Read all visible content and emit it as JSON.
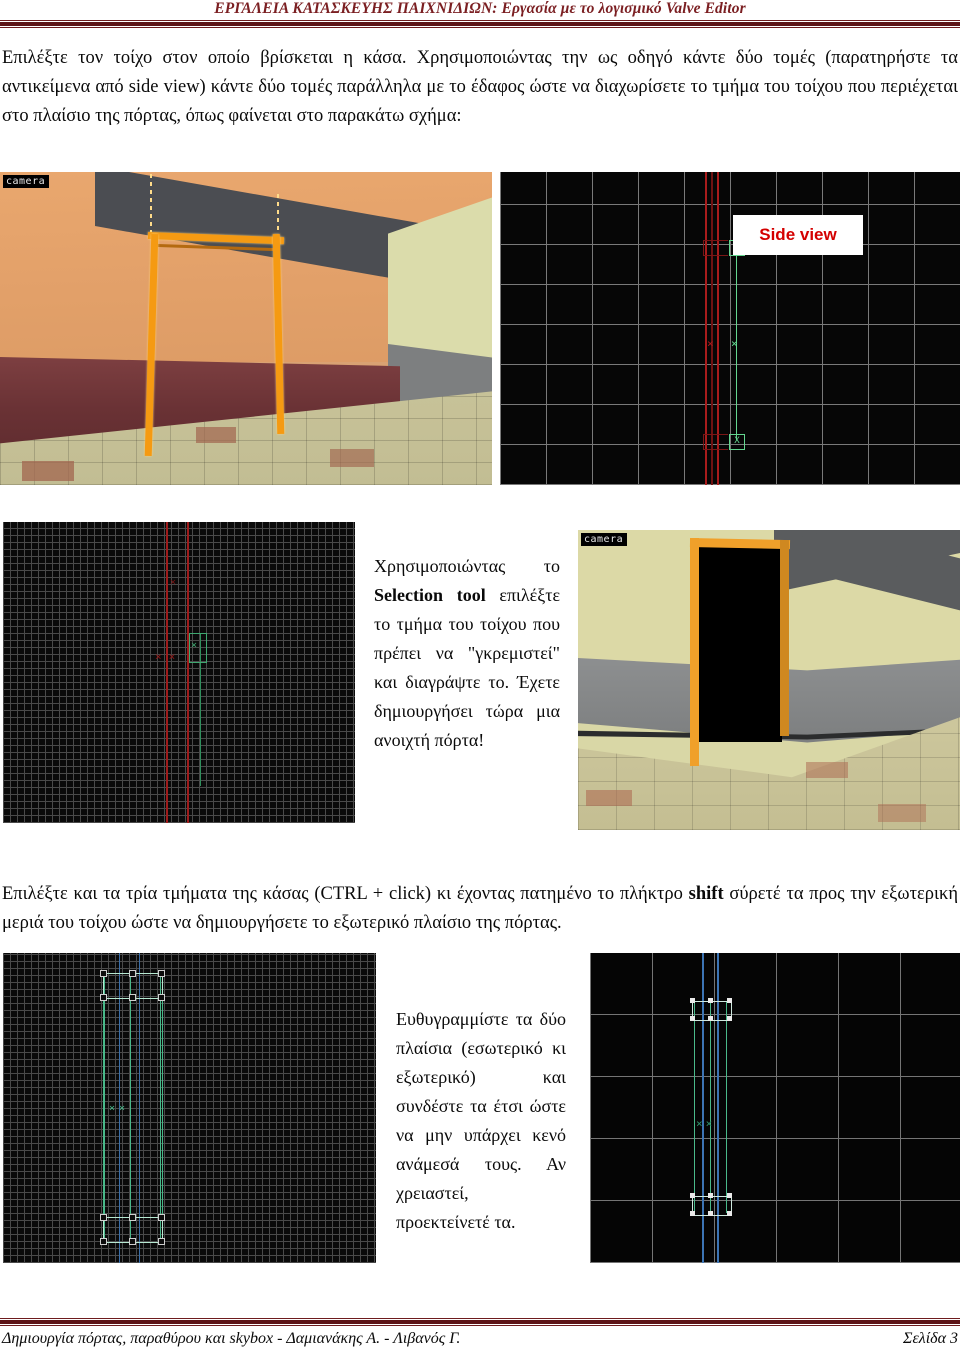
{
  "header": {
    "title": "ΕΡΓΑΛΕΙΑ ΚΑΤΑΣΚΕΥΗΣ ΠΑΙΧΝΙΔΙΩΝ: Εργασία με το λογισμικό Valve Editor"
  },
  "paragraphs": {
    "p1": "Επιλέξτε τον τοίχο στον οποίο βρίσκεται η κάσα. Χρησιμοποιώντας την ως οδηγό κάντε δύο τομές (παρατηρήστε τα αντικείμενα από side view) κάντε δύο τομές παράλληλα με το έδαφος ώστε να διαχωρίσετε το τμήμα του τοίχου που περιέχεται στο πλαίσιο της πόρτας, όπως φαίνεται στο παρακάτω σχήμα:",
    "p2_part1": "Επιλέξτε και τα τρία τμήματα της κάσας (CTRL + click) κι έχοντας πατημένο το πλήκτρο ",
    "p2_bold": "shift",
    "p2_part2": " σύρετέ τα προς την εξωτερική μεριά του τοίχου ώστε να δημιουργήσετε το εξωτερικό πλαίσιο της πόρτας."
  },
  "figures": {
    "camera_label": "camera",
    "side_view_callout": "Side view"
  },
  "side_text": {
    "mid_part1": "Χρησιμοποιώντας το ",
    "mid_bold": "Selection tool",
    "mid_part2": " επιλέξτε το τμήμα του τοίχου που πρέπει να \"γκρεμιστεί\" και διαγράψτε το. Έχετε δημιουργήσει τώρα μια ανοιχτή πόρτα!",
    "bottom": "Ευθυγραμμίστε τα δύο πλαίσια (εσωτερικό κι εξωτερικό) και συνδέστε τα έτσι ώστε να μην υπάρχει κενό ανάμεσά τους. Αν χρειαστεί, προεκτείνετέ τα."
  },
  "footer": {
    "left": "Δημιουργία πόρτας, παραθύρου και skybox - Δαμιανάκης Α. - Λιβανός Γ.",
    "right": "Σελίδα 3"
  },
  "colors": {
    "header_accent": "#5d1417",
    "callout_text": "#d40000",
    "selection_orange": "#f0a02a",
    "grid_red": "#a81c1c",
    "grid_green": "#49b98a",
    "grid_blue": "#3c74b4"
  }
}
